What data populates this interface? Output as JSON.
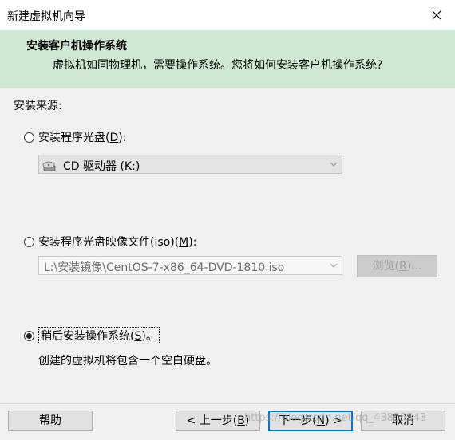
{
  "window": {
    "title": "新建虚拟机向导"
  },
  "header": {
    "title": "安装客户机操作系统",
    "subtitle": "虚拟机如同物理机，需要操作系统。您将如何安装客户机操作系统?"
  },
  "source": {
    "label": "安装来源:",
    "disc": {
      "label_prefix": "安装程序光盘(",
      "mnemonic": "D",
      "label_suffix": "):",
      "drive": "CD 驱动器 (K:)",
      "selected": false
    },
    "iso": {
      "label_prefix": "安装程序光盘映像文件(iso)(",
      "mnemonic": "M",
      "label_suffix": "):",
      "path": "L:\\安装镜像\\CentOS-7-x86_64-DVD-1810.iso",
      "browse_prefix": "浏览(",
      "browse_mnemonic": "R",
      "browse_suffix": ")...",
      "selected": false
    },
    "later": {
      "label_prefix": "稍后安装操作系统(",
      "mnemonic": "S",
      "label_suffix": ")。",
      "selected": true,
      "description": "创建的虚拟机将包含一个空白硬盘。"
    }
  },
  "footer": {
    "help": "帮助",
    "back_prefix": "< 上一步(",
    "back_mnemonic": "B",
    "back_suffix": ")",
    "next_prefix": "下一步(",
    "next_mnemonic": "N",
    "next_suffix": ") >",
    "cancel": "取消"
  },
  "watermark": "https://blog.csdn.net/qq_43855543",
  "colors": {
    "header_bg": "#cfe8d1",
    "content_bg": "#f0f0f0",
    "primary_border": "#0078d7"
  }
}
